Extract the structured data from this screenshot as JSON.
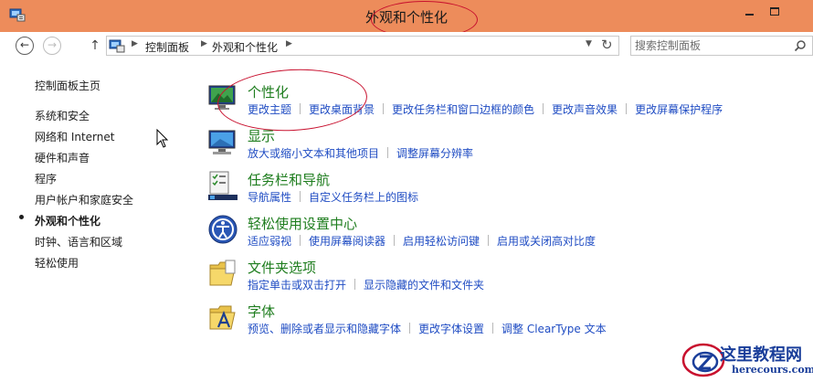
{
  "window": {
    "title": "外观和个性化",
    "accent_color": "#ed8c5b",
    "title_icon": "control-panel-icon"
  },
  "nav": {
    "back_icon": "back-arrow-icon",
    "forward_icon": "forward-arrow-icon",
    "up_icon": "up-arrow-icon",
    "breadcrumbs": [
      "控制面板",
      "外观和个性化"
    ],
    "refresh_icon": "refresh-icon",
    "search_placeholder": "搜索控制面板"
  },
  "sidebar": {
    "items": [
      {
        "label": "控制面板主页"
      },
      {
        "label": "系统和安全"
      },
      {
        "label": "网络和 Internet"
      },
      {
        "label": "硬件和声音"
      },
      {
        "label": "程序"
      },
      {
        "label": "用户帐户和家庭安全"
      },
      {
        "label": "外观和个性化",
        "active": true
      },
      {
        "label": "时钟、语言和区域"
      },
      {
        "label": "轻松使用"
      }
    ]
  },
  "categories": [
    {
      "title": "个性化",
      "icon": "personalization-icon",
      "links": [
        "更改主题",
        "更改桌面背景",
        "更改任务栏和窗口边框的颜色",
        "更改声音效果",
        "更改屏幕保护程序"
      ]
    },
    {
      "title": "显示",
      "icon": "display-icon",
      "links": [
        "放大或缩小文本和其他项目",
        "调整屏幕分辨率"
      ]
    },
    {
      "title": "任务栏和导航",
      "icon": "taskbar-icon",
      "links": [
        "导航属性",
        "自定义任务栏上的图标"
      ]
    },
    {
      "title": "轻松使用设置中心",
      "icon": "ease-of-access-icon",
      "links": [
        "适应弱视",
        "使用屏幕阅读器",
        "启用轻松访问键",
        "启用或关闭高对比度"
      ]
    },
    {
      "title": "文件夹选项",
      "icon": "folder-options-icon",
      "links": [
        "指定单击或双击打开",
        "显示隐藏的文件和文件夹"
      ]
    },
    {
      "title": "字体",
      "icon": "fonts-icon",
      "links": [
        "预览、删除或者显示和隐藏字体",
        "更改字体设置",
        "调整 ClearType 文本"
      ]
    }
  ],
  "watermark": {
    "name": "这里教程网",
    "domain": "herecours.com"
  },
  "colors": {
    "link": "#1f4cc3",
    "category_title": "#1e7d1e",
    "annotation": "#c8102e"
  }
}
